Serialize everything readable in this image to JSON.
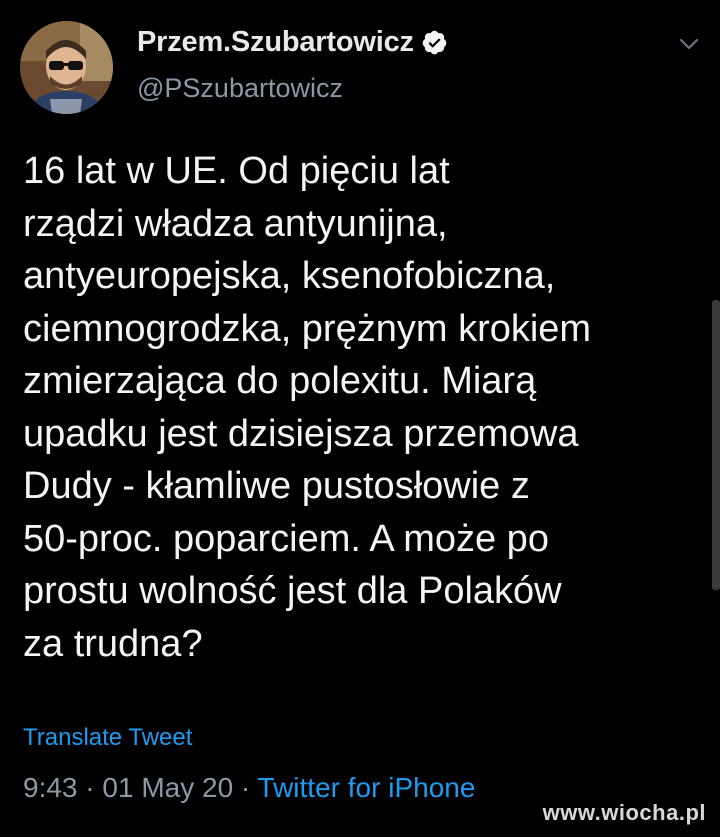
{
  "author": {
    "display_name": "Przem.Szubartowicz",
    "handle": "@PSzubartowicz",
    "verified": true
  },
  "tweet": {
    "lines": [
      "16 lat w UE. Od pięciu lat",
      "rządzi władza antyunijna,",
      "antyeuropejska, ksenofobiczna,",
      "ciemnogrodzka, prężnym krokiem",
      "zmierzająca do polexitu. Miarą",
      "upadku jest dzisiejsza przemowa",
      "Dudy - kłamliwe pustosłowie z",
      "50-proc. poparciem. A może po",
      "prostu wolność jest dla Polaków",
      "za trudna?"
    ],
    "translate_label": "Translate Tweet",
    "time": "9:43",
    "date": "01 May 20",
    "separator": "·",
    "source": "Twitter for iPhone"
  },
  "watermark": "www.wiocha.pl",
  "colors": {
    "background": "#000000",
    "accent": "#1d9bf0",
    "muted": "#8b98a5",
    "text": "#f2f4f5"
  },
  "icons": {
    "verified": "verified-badge-icon",
    "menu": "chevron-down-icon"
  }
}
